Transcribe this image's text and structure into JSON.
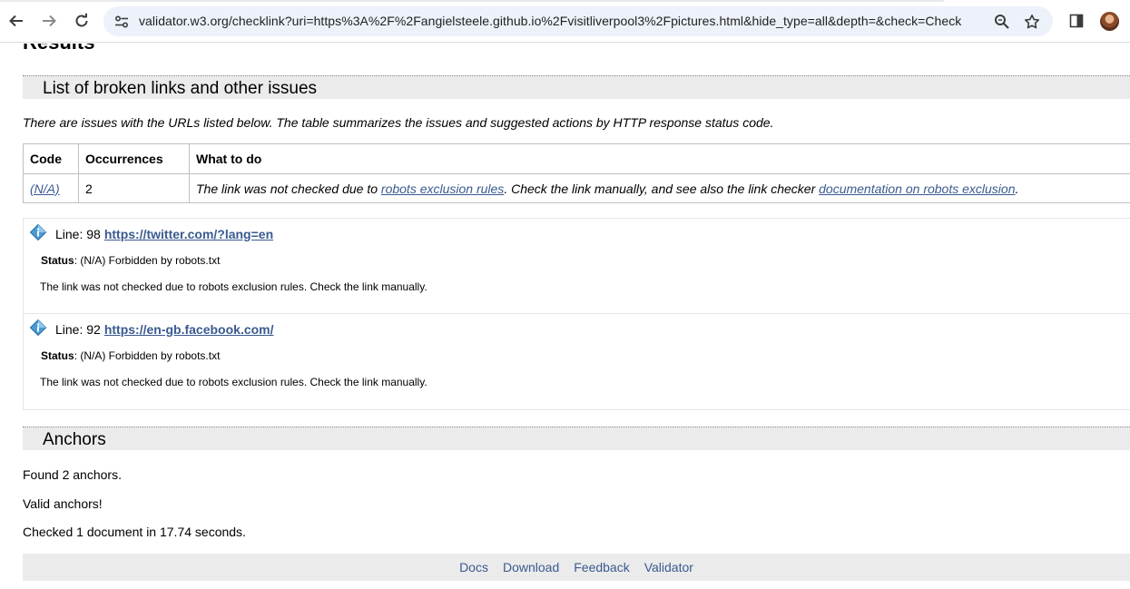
{
  "browser": {
    "url": "validator.w3.org/checklink?uri=https%3A%2F%2Fangielsteele.github.io%2Fvisitliverpool3%2Fpictures.html&hide_type=all&depth=&check=Check",
    "icons": [
      "back-arrow-icon",
      "forward-arrow-icon",
      "reload-icon",
      "site-settings-icon",
      "zoom-icon",
      "bookmark-star-icon",
      "side-panel-icon",
      "profile-avatar"
    ]
  },
  "page": {
    "results_title": "Results",
    "broken_section_title": "List of broken links and other issues",
    "intro": "There are issues with the URLs listed below. The table summarizes the issues and suggested actions by HTTP response status code.",
    "summary_table": {
      "headers": [
        "Code",
        "Occurrences",
        "What to do"
      ],
      "row": {
        "code": "(N/A)",
        "occurrences": "2",
        "what_to_do_prefix": "The link was not checked due to ",
        "what_to_do_link1": "robots exclusion rules",
        "what_to_do_middle": ". Check the link manually, and see also the link checker ",
        "what_to_do_link2": "documentation on robots exclusion",
        "what_to_do_suffix": "."
      }
    },
    "issues": [
      {
        "line_label": "Line: 98",
        "url": "https://twitter.com/?lang=en",
        "status_label": "Status",
        "status_text": ": (N/A) Forbidden by robots.txt",
        "message": "The link was not checked due to robots exclusion rules. Check the link manually."
      },
      {
        "line_label": "Line: 92",
        "url": "https://en-gb.facebook.com/",
        "status_label": "Status",
        "status_text": ": (N/A) Forbidden by robots.txt",
        "message": "The link was not checked due to robots exclusion rules. Check the link manually."
      }
    ],
    "anchors_section_title": "Anchors",
    "anchors_found": "Found 2 anchors.",
    "anchors_valid": "Valid anchors!",
    "checked_summary": "Checked 1 document in 17.74 seconds.",
    "footer_links": [
      "Docs",
      "Download",
      "Feedback",
      "Validator"
    ]
  }
}
